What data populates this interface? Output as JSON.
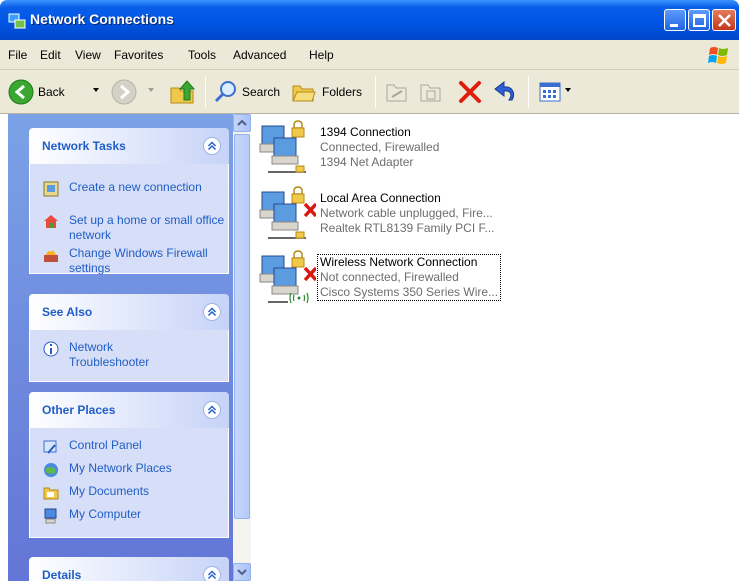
{
  "window": {
    "title": "Network Connections"
  },
  "menu": [
    "File",
    "Edit",
    "View",
    "Favorites",
    "Tools",
    "Advanced",
    "Help"
  ],
  "toolbar": {
    "back": "Back",
    "search": "Search",
    "folders": "Folders"
  },
  "panels": {
    "network_tasks": {
      "title": "Network Tasks",
      "items": [
        {
          "label": "Create a new connection",
          "icon": "new-connection-icon"
        },
        {
          "label": "Set up a home or small office network",
          "icon": "home-network-icon"
        },
        {
          "label": "Change Windows Firewall settings",
          "icon": "firewall-icon"
        }
      ]
    },
    "see_also": {
      "title": "See Also",
      "items": [
        {
          "label": "Network Troubleshooter",
          "icon": "info-icon"
        }
      ]
    },
    "other_places": {
      "title": "Other Places",
      "items": [
        {
          "label": "Control Panel",
          "icon": "control-panel-icon"
        },
        {
          "label": "My Network Places",
          "icon": "network-places-icon"
        },
        {
          "label": "My Documents",
          "icon": "documents-folder-icon"
        },
        {
          "label": "My Computer",
          "icon": "computer-icon"
        }
      ]
    },
    "details": {
      "title": "Details"
    }
  },
  "connections": [
    {
      "name": "1394 Connection",
      "status": "Connected, Firewalled",
      "device": "1394 Net Adapter"
    },
    {
      "name": "Local Area Connection",
      "status": "Network cable unplugged, Fire...",
      "device": "Realtek RTL8139 Family PCI F..."
    },
    {
      "name": "Wireless Network Connection",
      "status": "Not connected, Firewalled",
      "device": "Cisco Systems 350 Series Wire..."
    }
  ],
  "colors": {
    "titlebar": "#0055e5",
    "link": "#215dc6",
    "pane": "#6f8ee0"
  }
}
